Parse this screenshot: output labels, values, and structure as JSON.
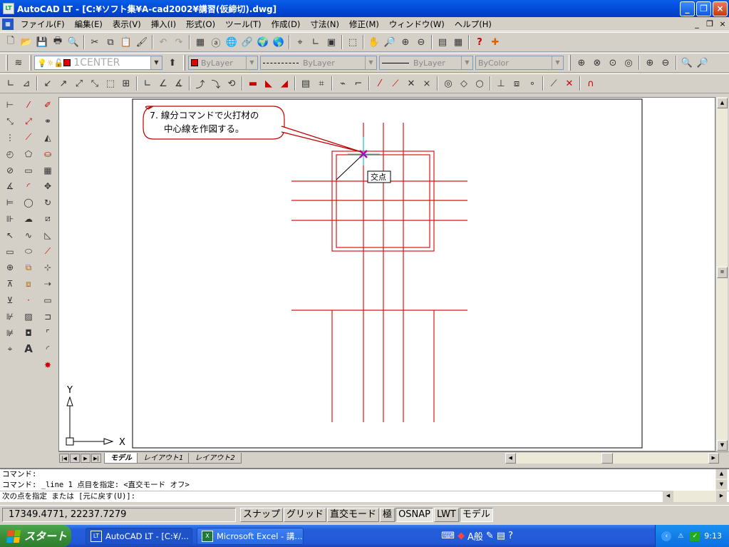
{
  "window": {
    "title": "AutoCAD LT - [C:¥ソフト集¥A-cad2002¥講習(仮締切).dwg]",
    "app_icon": "autocad-lt-icon",
    "controls": [
      "minimize",
      "maximize",
      "close"
    ]
  },
  "menu": {
    "items": [
      "ファイル(F)",
      "編集(E)",
      "表示(V)",
      "挿入(I)",
      "形式(O)",
      "ツール(T)",
      "作成(D)",
      "寸法(N)",
      "修正(M)",
      "ウィンドウ(W)",
      "ヘルプ(H)"
    ],
    "mdi": [
      "_",
      "❐",
      "×"
    ]
  },
  "layer_toolbar": {
    "layer_name": "1CENTER",
    "color": "ByLayer",
    "color_swatch": "#e00000",
    "linetype": "ByLayer",
    "lineweight": "ByLayer",
    "plotstyle": "ByColor"
  },
  "drawing": {
    "callout_line1": "7. 線分コマンドで火打材の",
    "callout_line2": "中心線を作図する。",
    "osnap_tooltip": "交点",
    "ucs_x_label": "X",
    "ucs_y_label": "Y",
    "line_color": "#dc1414",
    "marker_color": "#b800b8",
    "cursor_color": "#00e0e0"
  },
  "layout_tabs": {
    "tabs": [
      "モデル",
      "レイアウト1",
      "レイアウト2"
    ],
    "active": "モデル"
  },
  "command": {
    "line1": "コマンド:",
    "line2": "コマンド: _line 1 点目を指定:  <直交モード オフ>",
    "prompt": "次の点を指定 または [元に戻す(U)]:"
  },
  "status": {
    "coordinates": "17349.4771, 22237.7279",
    "buttons": [
      "スナップ",
      "グリッド",
      "直交モード",
      "極",
      "OSNAP",
      "LWT",
      "モデル"
    ],
    "active_buttons": [
      "OSNAP",
      "モデル"
    ]
  },
  "taskbar": {
    "start": "スタート",
    "tasks": [
      "AutoCAD LT - [C:¥/...",
      "Microsoft Excel - 講..."
    ],
    "ime": "A般",
    "clock": "9:13"
  }
}
